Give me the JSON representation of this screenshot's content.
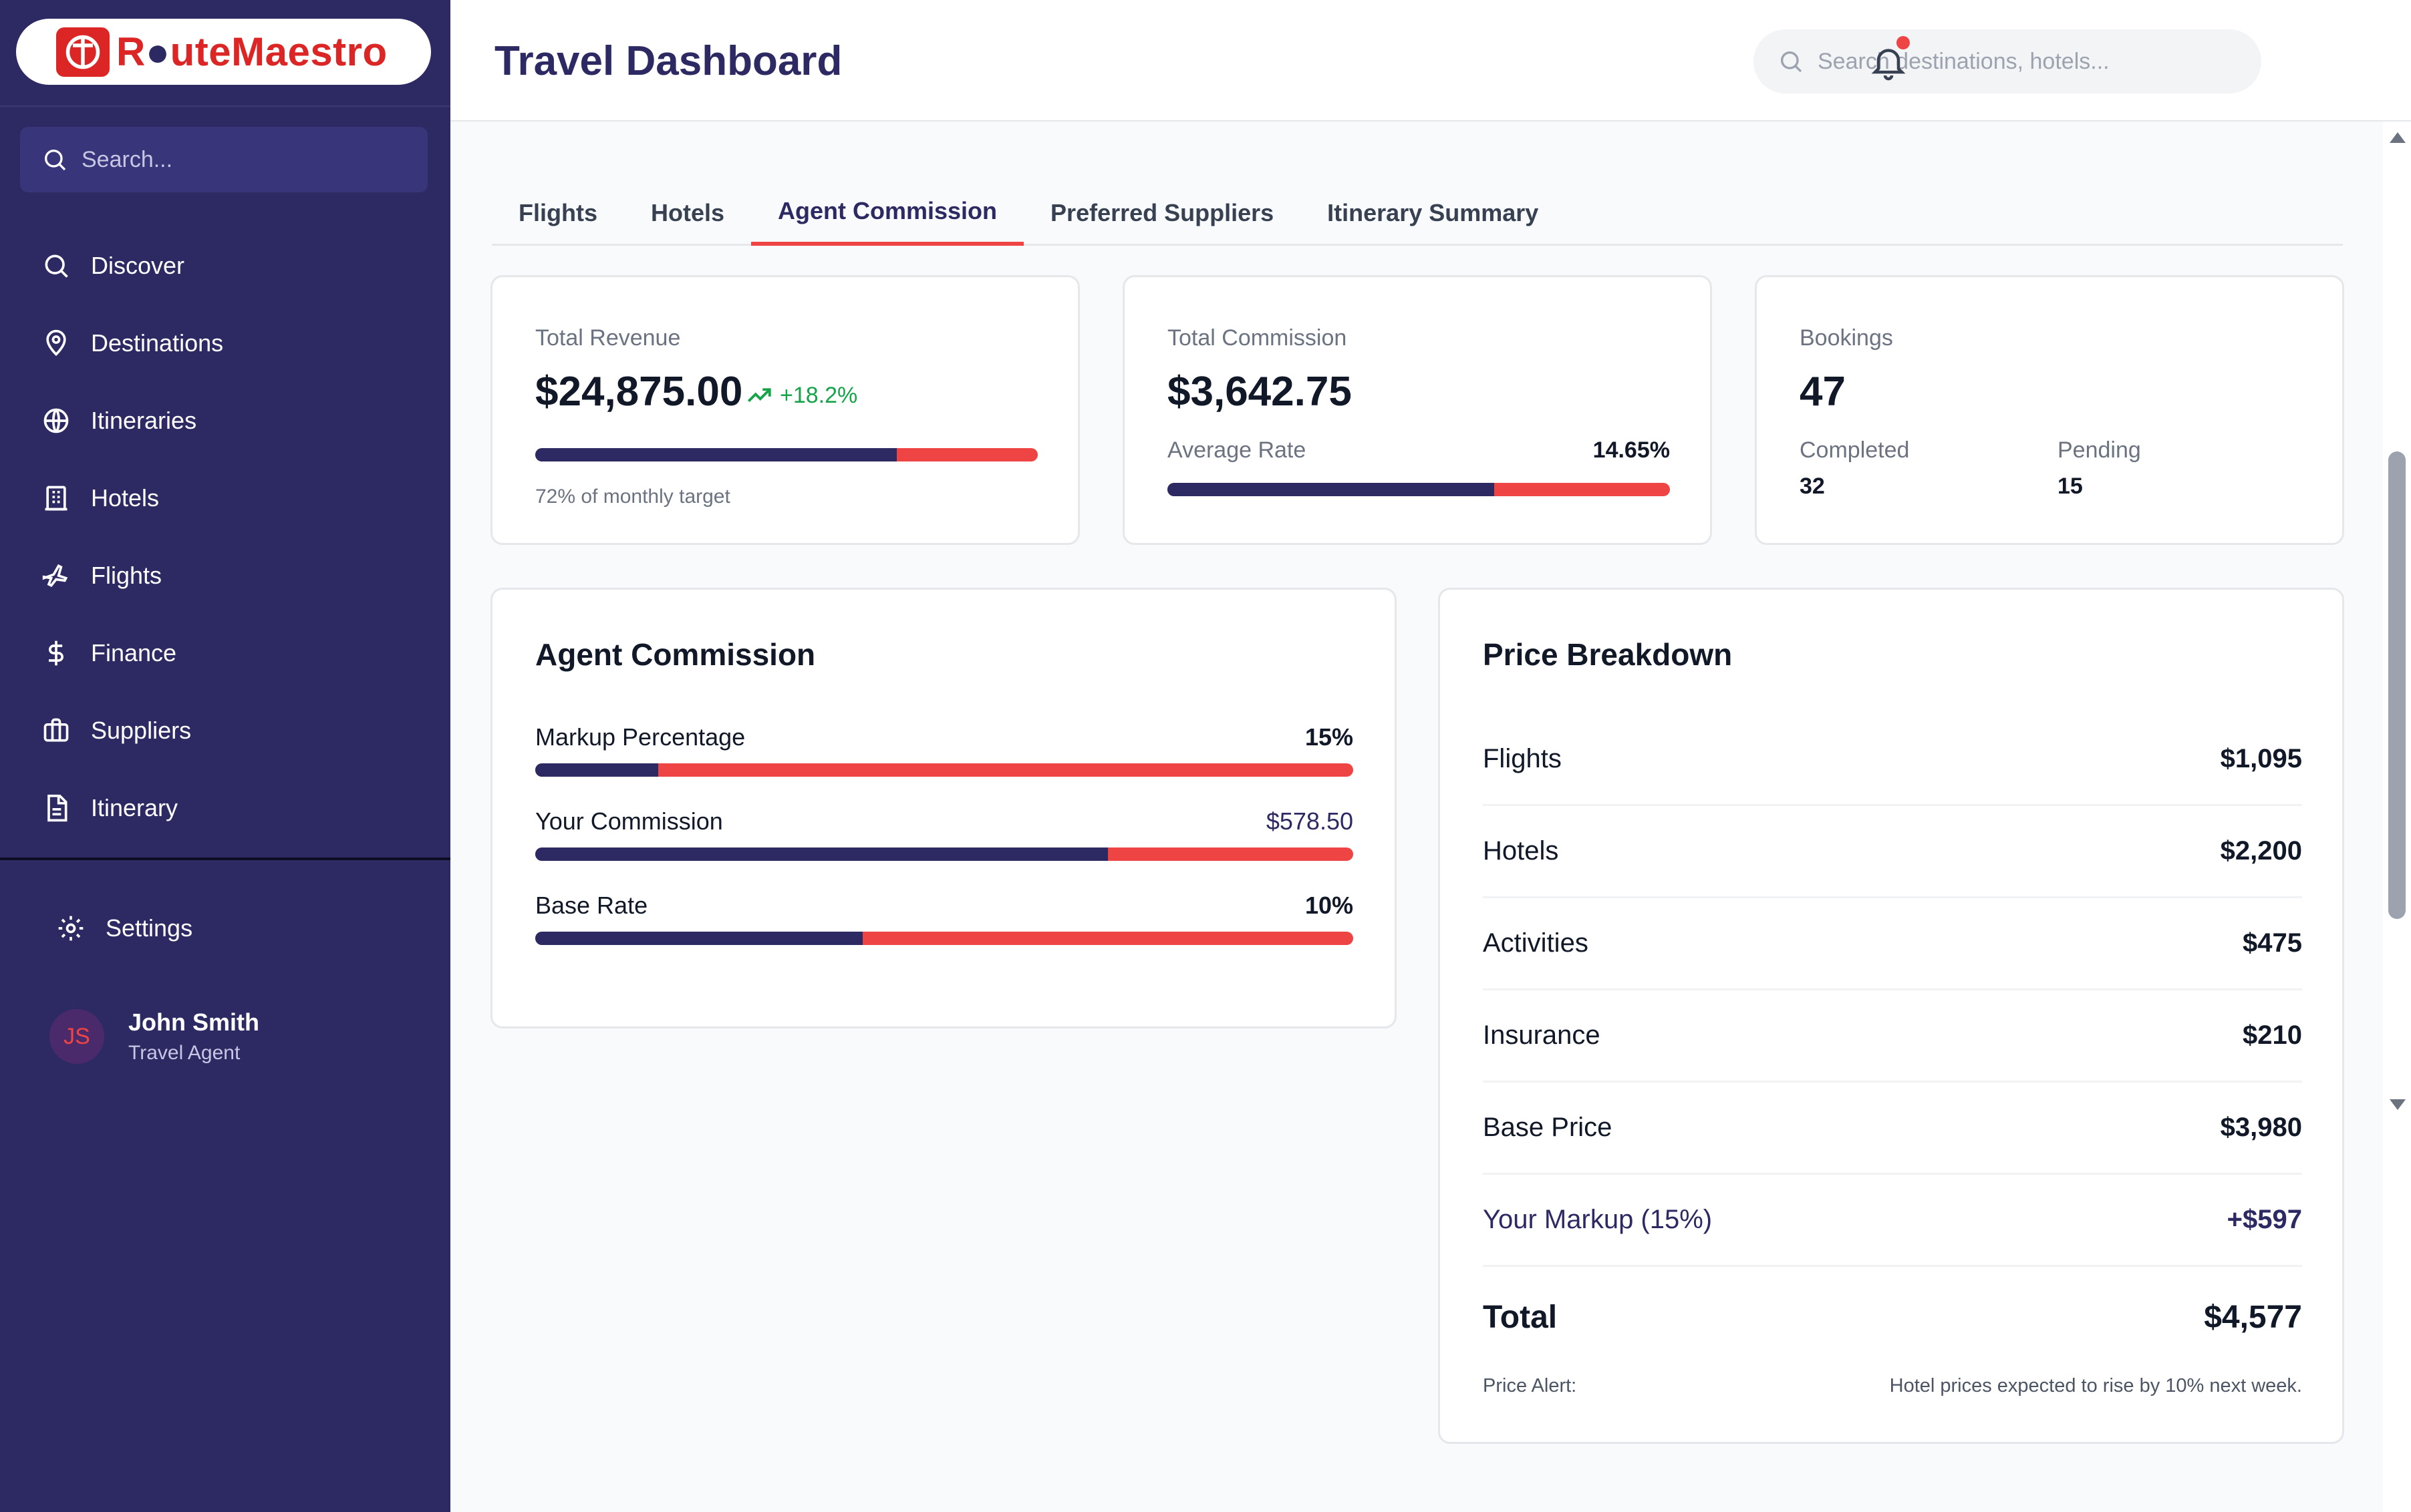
{
  "app": {
    "logo_text_a": "R",
    "logo_text_b": "uteMaestro",
    "brand_color": "#dc2626",
    "sidebar_color": "#2d2a63"
  },
  "sidebar": {
    "search_placeholder": "Search...",
    "items": [
      {
        "label": "Discover",
        "icon": "search-icon"
      },
      {
        "label": "Destinations",
        "icon": "map-pin-icon"
      },
      {
        "label": "Itineraries",
        "icon": "globe-icon"
      },
      {
        "label": "Hotels",
        "icon": "building-icon"
      },
      {
        "label": "Flights",
        "icon": "plane-icon"
      },
      {
        "label": "Finance",
        "icon": "dollar-icon"
      },
      {
        "label": "Suppliers",
        "icon": "briefcase-icon"
      },
      {
        "label": "Itinerary",
        "icon": "document-icon"
      }
    ],
    "settings_label": "Settings",
    "user": {
      "initials": "JS",
      "name": "John Smith",
      "role": "Travel Agent"
    }
  },
  "header": {
    "title": "Travel Dashboard",
    "search_placeholder": "Search destinations, hotels..."
  },
  "tabs": [
    {
      "label": "Flights",
      "active": false
    },
    {
      "label": "Hotels",
      "active": false
    },
    {
      "label": "Agent Commission",
      "active": true
    },
    {
      "label": "Preferred Suppliers",
      "active": false
    },
    {
      "label": "Itinerary Summary",
      "active": false
    }
  ],
  "stats": {
    "revenue": {
      "label": "Total Revenue",
      "value": "$24,875.00",
      "trend": "+18.2%",
      "progress": 0.72,
      "note": "72% of monthly target"
    },
    "commission": {
      "label": "Total Commission",
      "value": "$3,642.75",
      "rate_label": "Average Rate",
      "rate_value": "14.65%",
      "progress": 0.65
    },
    "bookings": {
      "label": "Bookings",
      "value": "47",
      "completed_label": "Completed",
      "completed_value": "32",
      "pending_label": "Pending",
      "pending_value": "15"
    }
  },
  "agent_commission": {
    "title": "Agent Commission",
    "rows": [
      {
        "label": "Markup Percentage",
        "value": "15%",
        "progress": 0.15
      },
      {
        "label": "Your Commission",
        "value": "$578.50",
        "progress": 0.7
      },
      {
        "label": "Base Rate",
        "value": "10%",
        "progress": 0.4
      }
    ]
  },
  "price_breakdown": {
    "title": "Price Breakdown",
    "rows": [
      {
        "label": "Flights",
        "value": "$1,095"
      },
      {
        "label": "Hotels",
        "value": "$2,200"
      },
      {
        "label": "Activities",
        "value": "$475"
      },
      {
        "label": "Insurance",
        "value": "$210"
      },
      {
        "label": "Base Price",
        "value": "$3,980"
      },
      {
        "label": "Your Markup (15%)",
        "value": "+$597"
      }
    ],
    "total_label": "Total",
    "total_value": "$4,577",
    "alert_label": "Price Alert:",
    "alert_text": "Hotel prices expected to rise by 10% next week."
  }
}
